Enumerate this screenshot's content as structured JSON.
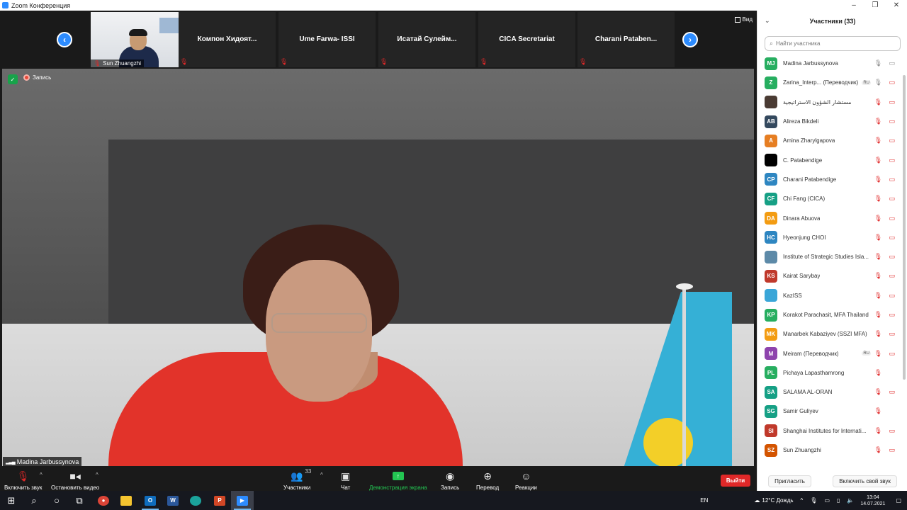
{
  "window": {
    "title": "Zoom Конференция",
    "buttons": [
      "–",
      "❐",
      "✕"
    ]
  },
  "strip": {
    "thumbs": [
      {
        "name": "Sun Zhuangzhi",
        "has_video": true
      },
      {
        "name": "Компон  Хидоят...",
        "has_video": false
      },
      {
        "name": "Ume Farwa- ISSI",
        "has_video": false
      },
      {
        "name": "Исатай  Сулейм...",
        "has_video": false
      },
      {
        "name": "CICA Secretariat",
        "has_video": false
      },
      {
        "name": "Charani  Pataben...",
        "has_video": false
      }
    ],
    "view_label": "Вид"
  },
  "main": {
    "recording_label": "Запись",
    "speaker_name": "Madina Jarbussynova"
  },
  "toolbar": {
    "unmute": "Включить звук",
    "stop_video": "Остановить видео",
    "participants": "Участники",
    "participants_count": "33",
    "chat": "Чат",
    "share": "Демонстрация экрана",
    "record": "Запись",
    "translate": "Перевод",
    "reactions": "Реакции",
    "leave": "Выйти"
  },
  "panel": {
    "title": "Участники (33)",
    "search_placeholder": "Найти участника",
    "invite": "Пригласить",
    "unmute_self": "Включить свой звук",
    "participants": [
      {
        "initials": "MJ",
        "color": "#27ae60",
        "name": "Madina Jarbussynova",
        "tag": "",
        "mic": "on",
        "cam": "on"
      },
      {
        "initials": "Z",
        "color": "#27ae60",
        "name": "Zarina_Interp... (Переводчик)",
        "tag": "RU",
        "mic": "on",
        "cam": "off"
      },
      {
        "initials": "",
        "color": "#4a3b33",
        "name": "مستشار الشؤون الاستراتيجية",
        "tag": "",
        "mic": "muted",
        "cam": "off"
      },
      {
        "initials": "AB",
        "color": "#34495e",
        "name": "Alireza Bikdeli",
        "tag": "",
        "mic": "muted",
        "cam": "off"
      },
      {
        "initials": "A",
        "color": "#e67e22",
        "name": "Amina Zharylgapova",
        "tag": "",
        "mic": "muted",
        "cam": "off"
      },
      {
        "initials": "",
        "color": "#000000",
        "name": "C. Patabendige",
        "tag": "",
        "mic": "muted",
        "cam": "off"
      },
      {
        "initials": "CP",
        "color": "#2e86c1",
        "name": "Charani Patabendige",
        "tag": "",
        "mic": "muted",
        "cam": "off"
      },
      {
        "initials": "CF",
        "color": "#16a085",
        "name": "Chi Fang (CICA)",
        "tag": "",
        "mic": "muted",
        "cam": "off"
      },
      {
        "initials": "DA",
        "color": "#f39c12",
        "name": "Dinara Abuova",
        "tag": "",
        "mic": "muted",
        "cam": "off"
      },
      {
        "initials": "HC",
        "color": "#2e86c1",
        "name": "Hyeonjung CHOI",
        "tag": "",
        "mic": "muted",
        "cam": "off"
      },
      {
        "initials": "",
        "color": "#5d8aa8",
        "name": "Institute of Strategic Studies Isla...",
        "tag": "",
        "mic": "muted",
        "cam": "off"
      },
      {
        "initials": "KS",
        "color": "#c0392b",
        "name": "Kairat Sarybay",
        "tag": "",
        "mic": "muted",
        "cam": "off"
      },
      {
        "initials": "",
        "color": "#3aa6d8",
        "name": "KazISS",
        "tag": "",
        "mic": "muted",
        "cam": "off"
      },
      {
        "initials": "KP",
        "color": "#27ae60",
        "name": "Korakot Parachasit, MFA Thailand",
        "tag": "",
        "mic": "muted",
        "cam": "off"
      },
      {
        "initials": "MK",
        "color": "#f39c12",
        "name": "Manarbek Kabaziyev (SSZI MFA)",
        "tag": "",
        "mic": "muted",
        "cam": "off"
      },
      {
        "initials": "M",
        "color": "#8e44ad",
        "name": "Meiram (Переводчик)",
        "tag": "RU",
        "mic": "muted",
        "cam": "off"
      },
      {
        "initials": "PL",
        "color": "#27ae60",
        "name": "Pichaya Lapasthamrong",
        "tag": "",
        "mic": "muted",
        "cam": ""
      },
      {
        "initials": "SA",
        "color": "#16a085",
        "name": "SALAMA AL-ORAN",
        "tag": "",
        "mic": "muted",
        "cam": "off"
      },
      {
        "initials": "SG",
        "color": "#16a085",
        "name": "Samir Guliyev",
        "tag": "",
        "mic": "muted",
        "cam": ""
      },
      {
        "initials": "SI",
        "color": "#c0392b",
        "name": "Shanghai Institutes for Internati...",
        "tag": "",
        "mic": "muted",
        "cam": "off"
      },
      {
        "initials": "SZ",
        "color": "#d35400",
        "name": "Sun Zhuangzhi",
        "tag": "",
        "mic": "muted",
        "cam": "off"
      }
    ]
  },
  "taskbar": {
    "lang": "EN",
    "weather": "12°C  Дождь",
    "time": "13:04",
    "date": "14.07.2021"
  }
}
